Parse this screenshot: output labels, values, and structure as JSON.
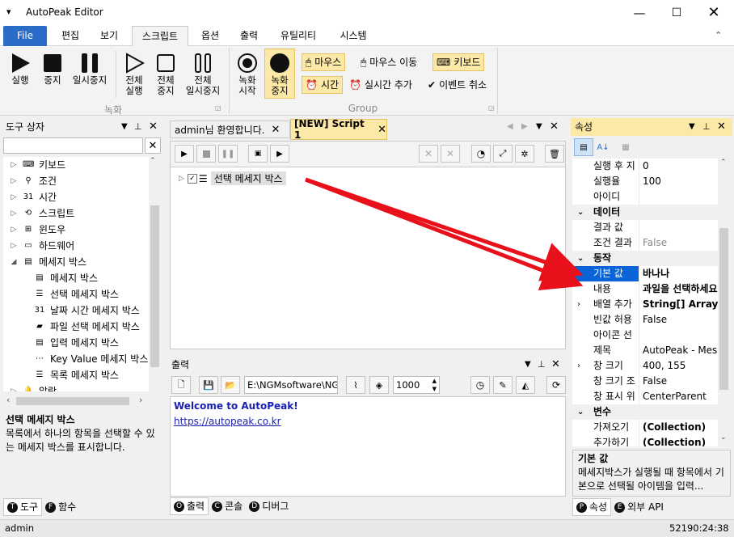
{
  "window": {
    "title": "AutoPeak Editor"
  },
  "menu": [
    "File",
    "편집",
    "보기",
    "스크립트",
    "옵션",
    "출력",
    "유틸리티",
    "시스템"
  ],
  "ribbon": {
    "record_group": "녹화",
    "group_group": "Group",
    "run": [
      "실행"
    ],
    "stop": [
      "중지"
    ],
    "pause": [
      "일시중지"
    ],
    "run_all": [
      "전체",
      "실행"
    ],
    "stop_all": [
      "전체",
      "중지"
    ],
    "pause_all": [
      "전체",
      "일시중지"
    ],
    "rec_start": [
      "녹화",
      "시작"
    ],
    "rec_stop": [
      "녹화",
      "중지"
    ],
    "mouse": "마우스",
    "mouse_move": "마우스 이동",
    "keyboard": "키보드",
    "time": "시간",
    "realtime_add": "실시간 추가",
    "event_cancel": "이벤트 취소"
  },
  "toolbox": {
    "title": "도구 상자",
    "items": [
      {
        "label": "키보드",
        "indent": 0,
        "exp": "▷",
        "icon": "⌨"
      },
      {
        "label": "조건",
        "indent": 0,
        "exp": "▷",
        "icon": "⚲"
      },
      {
        "label": "시간",
        "indent": 0,
        "exp": "▷",
        "icon": "31"
      },
      {
        "label": "스크립트",
        "indent": 0,
        "exp": "▷",
        "icon": "⟲"
      },
      {
        "label": "윈도우",
        "indent": 0,
        "exp": "▷",
        "icon": "⊞"
      },
      {
        "label": "하드웨어",
        "indent": 0,
        "exp": "▷",
        "icon": "▭"
      },
      {
        "label": "메세지 박스",
        "indent": 0,
        "exp": "◢",
        "icon": "▤"
      },
      {
        "label": "메세지 박스",
        "indent": 1,
        "exp": "",
        "icon": "▤"
      },
      {
        "label": "선택 메세지 박스",
        "indent": 1,
        "exp": "",
        "icon": "☰"
      },
      {
        "label": "날짜 시간 메세지 박스",
        "indent": 1,
        "exp": "",
        "icon": "31"
      },
      {
        "label": "파일 선택 메세지 박스",
        "indent": 1,
        "exp": "",
        "icon": "▰"
      },
      {
        "label": "입력 메세지 박스",
        "indent": 1,
        "exp": "",
        "icon": "▤"
      },
      {
        "label": "Key Value 메세지 박스",
        "indent": 1,
        "exp": "",
        "icon": "⋯"
      },
      {
        "label": "목록 메세지 박스",
        "indent": 1,
        "exp": "",
        "icon": "☰"
      },
      {
        "label": "알람",
        "indent": 0,
        "exp": "▷",
        "icon": "🔔"
      }
    ],
    "desc_title": "선택 메세지 박스",
    "desc_text": "목록에서 하나의 항목을 선택할 수 있는 메세지 박스를 표시합니다.",
    "tabs": [
      {
        "icon": "T",
        "label": "도구"
      },
      {
        "icon": "F",
        "label": "함수"
      }
    ]
  },
  "editor": {
    "tabs": [
      "admin님 환영합니다.",
      "[NEW] Script 1"
    ],
    "node_label": "선택 메세지 박스"
  },
  "output": {
    "title": "출력",
    "path": "E:\\NGMsoftware\\NG",
    "number": "1000",
    "welcome": "Welcome to AutoPeak!",
    "link": "https://autopeak.co.kr",
    "tabs": [
      {
        "icon": "O",
        "label": "출력"
      },
      {
        "icon": "C",
        "label": "콘솔"
      },
      {
        "icon": "D",
        "label": "디버그"
      }
    ]
  },
  "properties": {
    "title": "속성",
    "rows": [
      {
        "k": "실행 후 지",
        "v": "0"
      },
      {
        "k": "실행율",
        "v": "100"
      },
      {
        "k": "아이디",
        "v": ""
      },
      {
        "cat": "데이터"
      },
      {
        "k": "결과 값",
        "v": ""
      },
      {
        "k": "조건 결과",
        "v": "False",
        "gray": true
      },
      {
        "cat": "동작"
      },
      {
        "k": "기본 값",
        "v": "바나나",
        "sel": true,
        "bold": true
      },
      {
        "k": "내용",
        "v": "과일을 선택하세요",
        "bold": true
      },
      {
        "k": "배열 추가",
        "v": "String[] Array",
        "bold": true,
        "exp": true
      },
      {
        "k": "빈값 허용",
        "v": "False"
      },
      {
        "k": "아이콘 선",
        "v": ""
      },
      {
        "k": "제목",
        "v": "AutoPeak - Messa"
      },
      {
        "k": "창 크기",
        "v": "400, 155",
        "exp": true
      },
      {
        "k": "창 크기 조",
        "v": "False"
      },
      {
        "k": "창 표시 위",
        "v": "CenterParent"
      },
      {
        "cat": "변수"
      },
      {
        "k": "가져오기",
        "v": "(Collection)",
        "bold": true
      },
      {
        "k": "추가하기",
        "v": "(Collection)",
        "bold": true
      }
    ],
    "desc_title": "기본 값",
    "desc_text": "메세지박스가 실행될 때 항목에서 기본으로 선택될 아이템을 입력...",
    "tabs": [
      {
        "icon": "P",
        "label": "속성"
      },
      {
        "icon": "E",
        "label": "외부 API"
      }
    ]
  },
  "status": {
    "user": "admin",
    "time": "52190:24:38"
  }
}
